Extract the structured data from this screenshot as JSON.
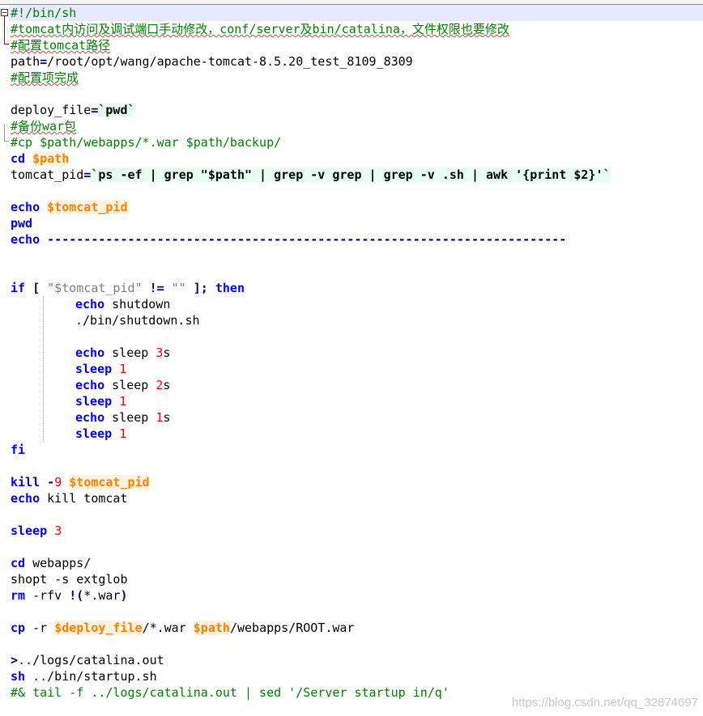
{
  "editor": {
    "lines": {
      "l1": "#!/bin/sh",
      "l2": "#tomcat内访问及调试端口手动修改，conf/server及bin/catalina，文件权限也要修改",
      "l3": "#配置tomcat路径",
      "l4a": "path",
      "l4b": "=",
      "l4c": "/root/opt/wang/apache-tomcat-8.5.20_test_8109_8309",
      "l5": "#配置项完成",
      "l7a": "deploy_file",
      "l7b": "=",
      "l7c": "`pwd`",
      "l8": "#备份war包",
      "l9": "#cp $path/webapps/*.war $path/backup/",
      "l10a": "cd",
      "l10b": "$path",
      "l11a": "tomcat_pid",
      "l11b": "=",
      "l11c": "`ps -ef | grep \"$path\" | grep -v grep | grep -v .sh | awk '{print $2}'`",
      "l13a": "echo",
      "l13b": "$tomcat_pid",
      "l14": "pwd",
      "l15a": "echo",
      "l15b": "-----------------------------------------------------------------------",
      "l18a": "if",
      "l18b": "[",
      "l18c": "\"$tomcat_pid\"",
      "l18d": "!=",
      "l18e": "\"\"",
      "l18f": "];",
      "l18g": "then",
      "l19a": "echo",
      "l19b": "shutdown",
      "l20": "./bin/shutdown.sh",
      "l22a": "echo",
      "l22b": "sleep",
      "l22c": "3",
      "l22d": "s",
      "l23a": "sleep",
      "l23b": "1",
      "l24a": "echo",
      "l24b": "sleep",
      "l24c": "2",
      "l24d": "s",
      "l25a": "sleep",
      "l25b": "1",
      "l26a": "echo",
      "l26b": "sleep",
      "l26c": "1",
      "l26d": "s",
      "l27a": "sleep",
      "l27b": "1",
      "l28": "fi",
      "l30a": "kill",
      "l30b": "-",
      "l30c": "9",
      "l30d": "$tomcat_pid",
      "l31a": "echo",
      "l31b": "kill tomcat",
      "l33a": "sleep",
      "l33b": "3",
      "l35a": "cd",
      "l35b": "webapps/",
      "l36": "shopt -s extglob",
      "l37a": "rm",
      "l37b": "-rfv",
      "l37c": "!(",
      "l37d": "*.war",
      "l37e": ")",
      "l39a": "cp",
      "l39b": "-r",
      "l39c": "$deploy_file",
      "l39d": "/*.war",
      "l39e": "$path",
      "l39f": "/webapps/ROOT.war",
      "l41a": ">",
      "l41b": "../logs/catalina.out",
      "l42a": "sh",
      "l42b": "../bin/startup.sh",
      "l43": "#& tail -f ../logs/catalina.out | sed '/Server startup in/q'"
    }
  },
  "watermark": "https://blog.csdn.net/qq_32874697"
}
